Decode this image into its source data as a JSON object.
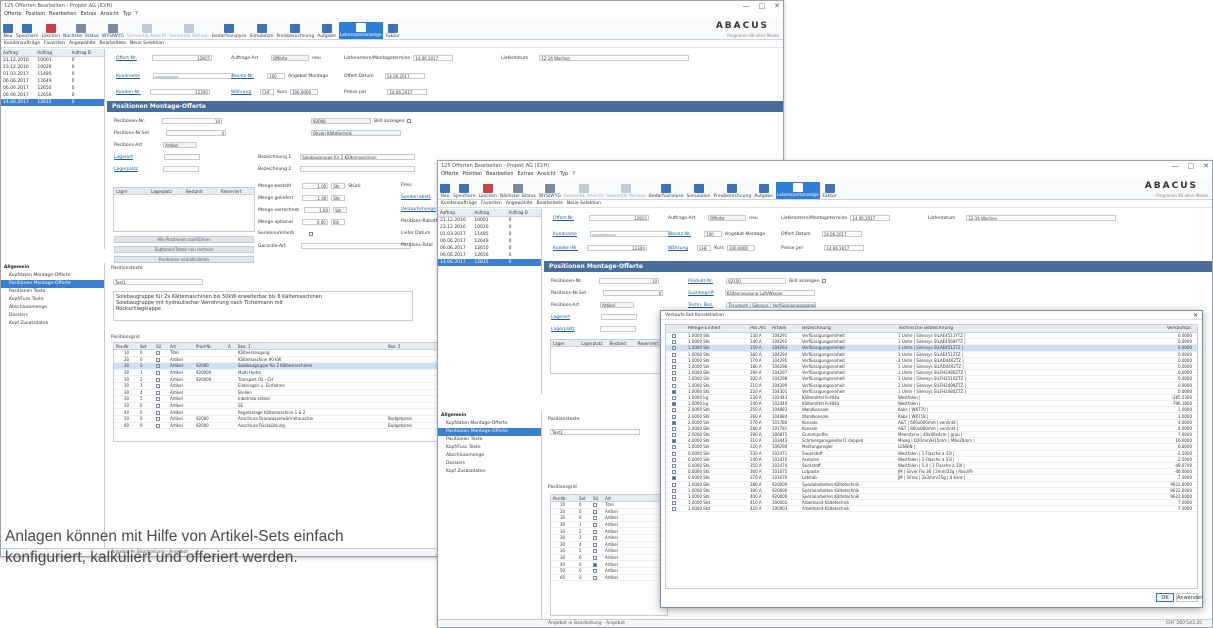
{
  "window1": {
    "title": "125 Offerten Bearbeiten - Projekt AG (ID/H)",
    "menu": [
      "Offerte",
      "Position",
      "Bearbeiten",
      "Extras",
      "Ansicht",
      "Typ",
      "?"
    ],
    "ribbon": [
      "Neu",
      "Speichern",
      "Löschen",
      "Nächster Status",
      "WYSIWYG",
      "Semantik Ansicht",
      "Semantik Vorlage",
      "Bedarfsanalyse",
      "Simulation",
      "Preisberechnung",
      "Aufgabe",
      "Lebenszeitanzeige",
      "Faktor"
    ],
    "subbar": [
      "Kundenaufträge",
      "Favoriten",
      "Angewählte",
      "Bearbeitete",
      "Neue Selektion"
    ],
    "logo": "ABACUS",
    "program_label": "Programm 80 ohne Marke",
    "list_headers": [
      "Auftrag",
      "Auftrag",
      "Auftrag D"
    ],
    "list_rows": [
      [
        "21.12.2016",
        "10001",
        "0"
      ],
      [
        "23.12.2016",
        "10026",
        "0"
      ],
      [
        "01.03.2017",
        "11485",
        "0"
      ],
      [
        "06.06.2017",
        "12649",
        "0"
      ],
      [
        "06.06.2017",
        "12650",
        "0"
      ],
      [
        "06.06.2017",
        "12656",
        "0"
      ],
      [
        "14.06.2017",
        "12815",
        "0"
      ]
    ],
    "header_fields": {
      "offer_no_label": "Offert-Nr.",
      "offer_no": "12815",
      "order_type_label": "Auftrags-Art",
      "order_type": "Offerte",
      "order_type_extra": "neu",
      "delivery_label": "Lieferantern/Montagetermine",
      "delivery": "14.06.2017",
      "delivery_date_label": "Lieferdatum",
      "delivery_weeks": "12-16 Wochen",
      "customer_label": "Kundname",
      "sales_label": "Absatz-Nr.",
      "sales": "100",
      "sales_text": "Angebot Montage",
      "offer_date_label": "Offert Datum",
      "offer_date": "14.06.2017",
      "customer_no_label": "Kunden-Nr.",
      "customer_no": "12300",
      "currency_label": "Währung",
      "currency": "CHF",
      "rate_label": "Kurs",
      "rate": "100.0000",
      "price_label": "Preise per",
      "price_date": "14.06.2017"
    },
    "banner": "Positionen Montage-Offerte",
    "pos_fields": {
      "pos_no_label": "Positionen-Nr.",
      "pos_no": "10",
      "pos_set_label": "Positions-Nr.Set",
      "pos_set": "0",
      "pos_type_label": "Positions-Art",
      "pos_type": "Artikel",
      "storage_label": "Lagerort",
      "storage_place_label": "Lagerplatz",
      "product_no": "92000",
      "image_label": "Bild anzeigen",
      "product_name": "Oliven Kältetechnik",
      "desc1_label": "Bezeichnung 1",
      "desc1": "Solebaugruppe für 2 Kältemaschinen",
      "desc2_label": "Bezeichnung 2",
      "qty_order_label": "Menge bestellt",
      "qty_order": "1.00",
      "qty_deliv_label": "Menge geliefert",
      "qty_deliv": "1.00",
      "qty_calc_label": "Menge verrechnet",
      "qty_calc": "1.00",
      "qty_opt_label": "Menge optional",
      "qty_opt": "0.00",
      "unit": "Stk",
      "unit_main": "Stück",
      "price_label": "Preis",
      "rabatt_label": "Sonderrabatt",
      "vat_label": "Verkaufsmenge",
      "margin_label": "Positions-Rabatt",
      "lief_label": "Liefer Datum",
      "pos_total_label": "Positions-Total",
      "serial_label": "Seriennummerb",
      "guarantee_label": "Garantie-Art"
    },
    "small_grid_headers": [
      "Lager",
      "Lagerplatz",
      "Bestand",
      "Reserviert"
    ],
    "left_buttons": [
      "Alle Positionen nachführen",
      "Subtotale/Totale neu rechnen",
      "Positionen vorkalkulieren"
    ],
    "nav_header": "Allgemein",
    "nav_items": [
      "Kopfdaten Montage-Offerte",
      "Positionen Montage-Offerte",
      "Positionen Texte",
      "Kopf/Fuss Texte",
      "Abschlussmenge",
      "Dossiers",
      "Kopf Zusatzdaten"
    ],
    "text_label": "Positionstexte",
    "text_tab": "Text1",
    "text_lines": [
      "Solebaugruppe für 2x Kältemaschinen bis 50kW erweiterbar bis 6 Kältemaschinen",
      "Solebaugruppe mit hydraulischer Verrohrung nach Tichelmann mit",
      "Rückschlagklappe"
    ],
    "pos_grid_label": "Positionsgrid",
    "pos_grid_headers": [
      "Pos-Nr.",
      "Set",
      "SU",
      "Art",
      "Prod-Nr.",
      "A",
      "Bez. 1",
      "Bez. 2"
    ],
    "pos_grid_rows": [
      [
        "10",
        "0",
        "Titel",
        "",
        "",
        "Kälteerzeugung",
        ""
      ],
      [
        "20",
        "0",
        "Artikel",
        "",
        "",
        "Kältemaschine 90 kW",
        ""
      ],
      [
        "30",
        "0",
        "Artikel",
        "92000",
        "",
        "Solebaugruppe für 2 Kältemaschinen",
        ""
      ],
      [
        "30",
        "1",
        "Artikel",
        "920000",
        "",
        "Multi Hydro",
        ""
      ],
      [
        "30",
        "2",
        "Artikel",
        "920000",
        "",
        "Transport Oil - CH",
        ""
      ],
      [
        "30",
        "3",
        "Artikel",
        "",
        "",
        "Einbringen u. Einfahren",
        ""
      ],
      [
        "30",
        "4",
        "Artikel",
        "",
        "",
        "Stellen",
        ""
      ],
      [
        "30",
        "5",
        "Artikel",
        "",
        "",
        "Inbetrieb setzen",
        ""
      ],
      [
        "30",
        "6",
        "Artikel",
        "",
        "",
        "SE",
        ""
      ],
      [
        "40",
        "0",
        "Artikel",
        "",
        "",
        "Regelanlage Kältemaschine 1 & 2",
        ""
      ],
      [
        "50",
        "0",
        "Artikel",
        "92000",
        "",
        "Anschluss Brauwasserwärmetauscher",
        "Budgetpreis"
      ],
      [
        "60",
        "0",
        "Artikel",
        "92000",
        "",
        "Anschluss Rückkühlung",
        "Budgetpreis"
      ]
    ],
    "status": "Angebot in Bearbeitung - Angebot"
  },
  "window2": {
    "title": "125 Offerten Bearbeiten - Projekt AG (ID/H)",
    "banner": "Positionen Montage-Offerte",
    "product_no_label": "Produkt-Nr.",
    "product_no": "92150",
    "suchbegriff_label": "Suchbegriff",
    "suchbegriff": "Kälteerzeugung Luft/Wasser",
    "tech_label": "Techn. Bez.",
    "tech": "Tecumseh | Silensys | Verflüssigungsaggreg.",
    "status": "Angebot in Bearbeitung - Angebot",
    "currency_footer": "CHF 260'543.35"
  },
  "dialog": {
    "title": "Verkaufs-Set Konstellation",
    "headers": [
      "",
      "Menge-Einheit",
      "Pos.Art",
      "Artikel",
      "Bezeichnung",
      "Technische Bezeichnung",
      "Verkaufspr."
    ],
    "rows": [
      [
        false,
        "1.0000 Stk",
        "130 A",
        "104291",
        "Verflüssigungseinheit",
        "1 Unite | Silensys SILAE4511YTZ |",
        "0.0000"
      ],
      [
        false,
        "1.0000 Stk",
        "140 A",
        "104292",
        "Verflüssigungseinheit",
        "1 Unite | Silensys SILAE4568YTZ |",
        "0.0000"
      ],
      [
        false,
        "1.0000 Stk",
        "150 A",
        "104293",
        "Verflüssigungseinheit",
        "1 Unite | Silensys SILAE4512TZ |",
        "0.0000"
      ],
      [
        false,
        "1.0000 Stk",
        "160 A",
        "104294",
        "Verflüssigungseinheit",
        "1 Unite | Silensys SILAE4512TZ |",
        "0.0000"
      ],
      [
        false,
        "1.0000 Stk",
        "170 A",
        "104295",
        "Verflüssigungseinheit",
        "1 Unite | Silensys SILAD4462TZ |",
        "0.0000"
      ],
      [
        false,
        "1.0000 Stk",
        "180 A",
        "104296",
        "Verflüssigungseinheit",
        "1 Unite | Silensys SILAD4492TZ |",
        "0.0000"
      ],
      [
        false,
        "1.0000 Stk",
        "190 A",
        "104297",
        "Verflüssigungseinheit",
        "1 Unite | Silensys SILFH2480ZTZ |",
        "0.0000"
      ],
      [
        false,
        "1.0000 Stk",
        "200 A",
        "104298",
        "Verflüssigungseinheit",
        "1 Unite | Silensys SILFH2510ZTZ |",
        "0.0000"
      ],
      [
        false,
        "1.0000 Stk",
        "210 A",
        "104299",
        "Verflüssigungseinheit",
        "1 Unite | Silensys SILFH2490ZTZ |",
        "0.0000"
      ],
      [
        true,
        "1.0000 Stk",
        "220 A",
        "104301",
        "Verflüssigungseinheit",
        "1 Unite | Silensys SILFH2480ZTZ |",
        "0.0000"
      ],
      [
        false,
        "1.0000 kg",
        "230 A",
        "102443",
        "Kältemittel R-404a",
        "Westfalen |",
        "-385.5300"
      ],
      [
        true,
        "1.0000 kg",
        "240 A",
        "102444",
        "Kältemittel R-404a",
        "Westfalen |",
        "-796.1800"
      ],
      [
        false,
        "2.0000 Stk",
        "250 A",
        "104883",
        "Wandkonsole",
        "Kabs | WK770 |",
        "1.0000"
      ],
      [
        false,
        "2.0000 Stk",
        "260 A",
        "104884",
        "Wandkonsole",
        "Kabs | WK718 |",
        "3.0000"
      ],
      [
        true,
        "2.0000 Stk",
        "270 A",
        "101780",
        "Konsole",
        "A&T | 606x600mm | verzinkt |",
        "4.0000"
      ],
      [
        false,
        "2.0000 Stk",
        "280 A",
        "101781",
        "Konsole",
        "A&T | 800x800mm | verzinkt |",
        "4.0000"
      ],
      [
        false,
        "2.0000 Stk",
        "290 A",
        "106875",
        "Gummipuffer",
        "Meerstone | 40x40x4cm | grau |",
        "7.0000"
      ],
      [
        true,
        "4.0000 Stk",
        "310 A",
        "103443",
        "Schmiergarngeleiter(1 doppel)",
        "Mixag | D20mm/H15mm | M8x20mm |",
        "16.0000"
      ],
      [
        false,
        "1.0000 Stk",
        "320 A",
        "106290",
        "Meldungsregler",
        "LENSIN |",
        "6.0000"
      ],
      [
        false,
        "0.0000 Stk",
        "330 A",
        "102471",
        "Sauerstoff",
        "Westfalen | 1 Flasche à 33l |",
        "-2.5000"
      ],
      [
        false,
        "0.0000 Stk",
        "240 A",
        "102470",
        "Acetylen",
        "Westfalen | 1 Flasche à 33l |",
        "-2.5000"
      ],
      [
        false,
        "0.0000 Stk",
        "350 A",
        "102474",
        "Stickstoff",
        "Westfalen | 5.0 | 1 Flasche à 50l |",
        "-49.0700"
      ],
      [
        false,
        "0.0000 Stk",
        "360 A",
        "101675",
        "Lotpaste",
        "JM | Silver Flo 36 | 2mm/22g | Rosinfh",
        "-46.0000"
      ],
      [
        true,
        "0.0000 Stk",
        "370 A",
        "101676",
        "Lötstab",
        "JM | Sifros | 3x3mm/25g | 4 Kant |",
        "7.0000"
      ],
      [
        false,
        "1.0000 Stk",
        "380 A",
        "920000",
        "Spezialarbeiten Kältetechnik",
        "",
        "9622.0000"
      ],
      [
        false,
        "1.0000 Stk",
        "390 A",
        "920000",
        "Spezialarbeiten Kältetechnik",
        "",
        "9622.0000"
      ],
      [
        false,
        "1.0000 Stk",
        "400 A",
        "920000",
        "Spezialarbeiten Kältetechnik",
        "",
        "9622.0000"
      ],
      [
        false,
        "1.0000 Std",
        "410 A",
        "100002",
        "Arbeitszeit Kältetechnik",
        "",
        "7.0000"
      ],
      [
        false,
        "1.0000 Std",
        "420 A",
        "100003",
        "Arbeitszeit Kältetechnik",
        "",
        "7.0000"
      ]
    ],
    "ok": "OK",
    "apply": "Anwenden"
  },
  "caption": "Anlagen können mit Hilfe von Artikel-Sets einfach konfiguriert, kalkuliert und offeriert werden."
}
